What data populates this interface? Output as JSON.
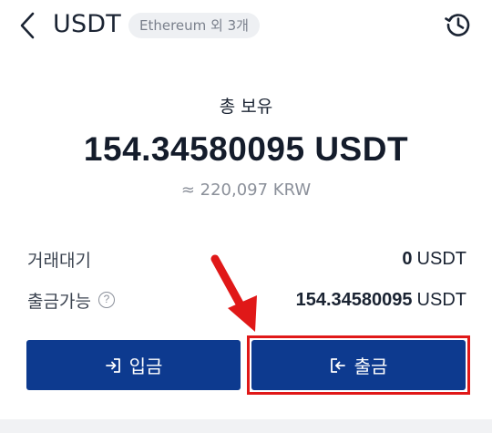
{
  "header": {
    "title": "USDT",
    "network_chip": "Ethereum 외 3개",
    "back_icon": "chevron-left-icon",
    "history_icon": "history-clock-icon"
  },
  "balance": {
    "label": "총 보유",
    "amount": "154.34580095 USDT",
    "fiat": "≈ 220,097 KRW"
  },
  "rows": {
    "pending": {
      "label": "거래대기",
      "value": "0",
      "unit": "USDT"
    },
    "available": {
      "label": "출금가능",
      "value": "154.34580095",
      "unit": "USDT",
      "help": "?"
    }
  },
  "buttons": {
    "deposit": "입금",
    "withdraw": "출금"
  },
  "colors": {
    "primary": "#0d3a8f",
    "highlight": "#e01818"
  }
}
